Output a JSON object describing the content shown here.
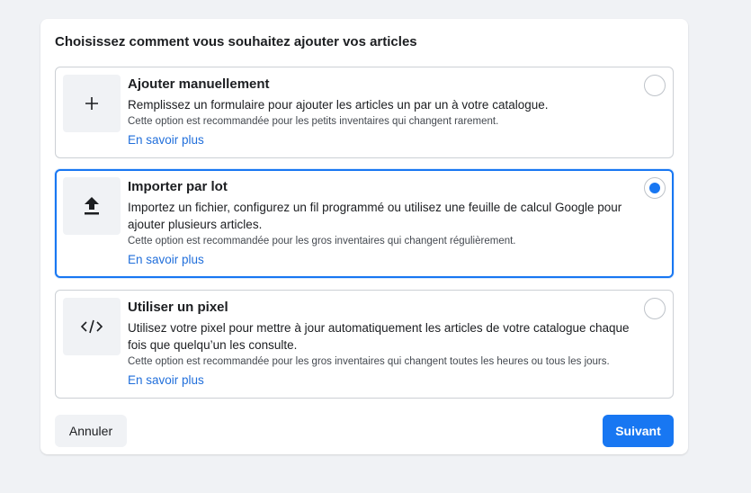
{
  "dialog": {
    "title": "Choisissez comment vous souhaitez ajouter vos articles"
  },
  "options": [
    {
      "icon": "plus-icon",
      "title": "Ajouter manuellement",
      "description": "Remplissez un formulaire pour ajouter les articles un par un à votre catalogue.",
      "note": "Cette option est recommandée pour les petits inventaires qui changent rarement.",
      "link": "En savoir plus",
      "selected": false
    },
    {
      "icon": "upload-icon",
      "title": "Importer par lot",
      "description": "Importez un fichier, configurez un fil programmé ou utilisez une feuille de calcul Google pour ajouter plusieurs articles.",
      "note": "Cette option est recommandée pour les gros inventaires qui changent régulièrement.",
      "link": "En savoir plus",
      "selected": true
    },
    {
      "icon": "code-icon",
      "title": "Utiliser un pixel",
      "description": "Utilisez votre pixel pour mettre à jour automatiquement les articles de votre catalogue chaque fois que quelqu’un les consulte.",
      "note": "Cette option est recommandée pour les gros inventaires qui changent toutes les heures ou tous les jours.",
      "link": "En savoir plus",
      "selected": false
    }
  ],
  "footer": {
    "cancel_label": "Annuler",
    "next_label": "Suivant"
  },
  "colors": {
    "accent": "#1877f2",
    "link": "#216fdb",
    "background": "#f0f2f5"
  }
}
